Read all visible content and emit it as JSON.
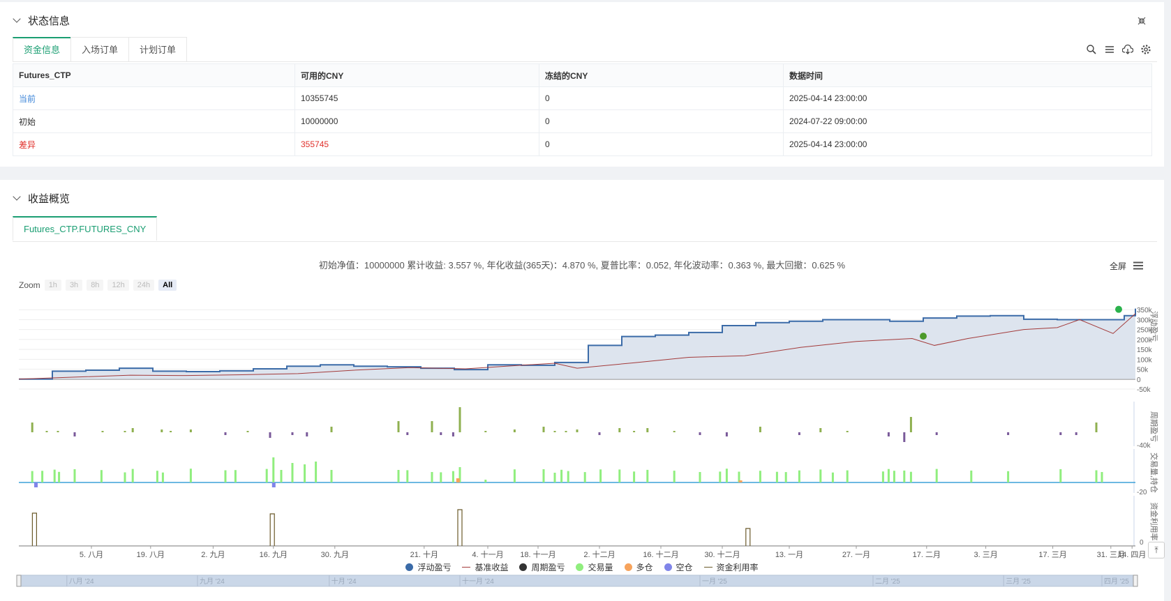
{
  "status_section": {
    "title": "状态信息"
  },
  "status_tabs": [
    {
      "label": "资金信息"
    },
    {
      "label": "入场订单"
    },
    {
      "label": "计划订单"
    }
  ],
  "table": {
    "headers": [
      "Futures_CTP",
      "可用的CNY",
      "冻结的CNY",
      "数据时间"
    ],
    "rows": [
      [
        "当前",
        "10355745",
        "0",
        "2025-04-14 23:00:00"
      ],
      [
        "初始",
        "10000000",
        "0",
        "2024-07-22 09:00:00"
      ],
      [
        "差异",
        "355745",
        "0",
        "2025-04-14 23:00:00"
      ]
    ]
  },
  "toolbar_icons": [
    "search-icon",
    "list-icon",
    "cloud-download-icon",
    "gear-icon",
    "collapse-icon"
  ],
  "profit_section": {
    "title": "收益概览"
  },
  "profit_tabs": [
    {
      "label": "Futures_CTP.FUTURES_CNY"
    }
  ],
  "stats_text": "初始净值：10000000 累计收益: 3.557 %, 年化收益(365天)：4.870 %, 夏普比率：0.052, 年化波动率：0.363 %, 最大回撤：0.625 %",
  "fullscreen_label": "全屏",
  "zoom": {
    "label": "Zoom",
    "buttons": [
      "1h",
      "3h",
      "8h",
      "12h",
      "24h",
      "All"
    ],
    "active": "All"
  },
  "colors": {
    "accent": "#1a9e72",
    "equity": "#3b6ba8",
    "benchmark": "#a33a3a",
    "profit_pos": "#8fb050",
    "profit_neg": "#7a5a9a",
    "volume": "#90ee7e",
    "long": "#f7a35c",
    "short": "#8085e9",
    "utilization": "#6b5a2a",
    "red_text": "#e0302b",
    "blue_text": "#3b84d8"
  },
  "chart_data": {
    "type": "line",
    "x_ticks": [
      "5. 八月",
      "19. 八月",
      "2. 九月",
      "16. 九月",
      "30. 九月",
      "21. 十月",
      "4. 十一月",
      "18. 十一月",
      "2. 十二月",
      "16. 十二月",
      "30. 十二月",
      "13. 一月",
      "27. 一月",
      "17. 二月",
      "3. 三月",
      "17. 三月",
      "31. 三月",
      "14. 四月"
    ],
    "nav_ticks": [
      "八月 '24",
      "九月 '24",
      "十月 '24",
      "十一月 '24",
      "一月 '25",
      "二月 '25",
      "三月 '25",
      "四月 '25"
    ],
    "panes": [
      {
        "axis_title": "浮动盈亏",
        "ticks": [
          "350k",
          "300k",
          "250k",
          "200k",
          "150k",
          "100k",
          "50k",
          "0",
          "-50k"
        ],
        "ylim": [
          -50000,
          400000
        ]
      },
      {
        "axis_title": "周期盈亏",
        "ticks": [
          "-40k"
        ]
      },
      {
        "axis_title": "交易量,持仓",
        "ticks": [
          "-20"
        ]
      },
      {
        "axis_title": "资金利用率",
        "ticks": [
          "0"
        ]
      }
    ],
    "series": [
      {
        "name": "浮动盈亏",
        "x": [
          0,
          3,
          6,
          9,
          12,
          15,
          18,
          21,
          24,
          27,
          30,
          33,
          36,
          39,
          42,
          45,
          48,
          51,
          54,
          57,
          60,
          63,
          66,
          69,
          72,
          75,
          78,
          81,
          84,
          87,
          90,
          93,
          96,
          99,
          100
        ],
        "y": [
          0,
          40000,
          45000,
          55000,
          40000,
          38000,
          42000,
          52000,
          65000,
          72000,
          65000,
          62000,
          55000,
          48000,
          72000,
          70000,
          84000,
          170000,
          215000,
          222000,
          235000,
          270000,
          285000,
          292000,
          300000,
          300000,
          292000,
          308000,
          318000,
          320000,
          302000,
          300000,
          300000,
          320000,
          355745
        ]
      },
      {
        "name": "基准收益",
        "x": [
          0,
          5,
          10,
          15,
          20,
          25,
          30,
          35,
          40,
          45,
          48,
          50,
          55,
          60,
          65,
          70,
          75,
          80,
          82,
          85,
          90,
          93,
          95,
          98,
          100
        ],
        "y": [
          0,
          10000,
          20000,
          18000,
          22000,
          28000,
          45000,
          58000,
          52000,
          70000,
          80000,
          55000,
          82000,
          110000,
          118000,
          160000,
          190000,
          205000,
          170000,
          205000,
          250000,
          260000,
          300000,
          230000,
          330000
        ]
      }
    ],
    "legend": [
      "浮动盈亏",
      "基准收益",
      "周期盈亏",
      "交易量",
      "多仓",
      "空仓",
      "资金利用率"
    ]
  }
}
